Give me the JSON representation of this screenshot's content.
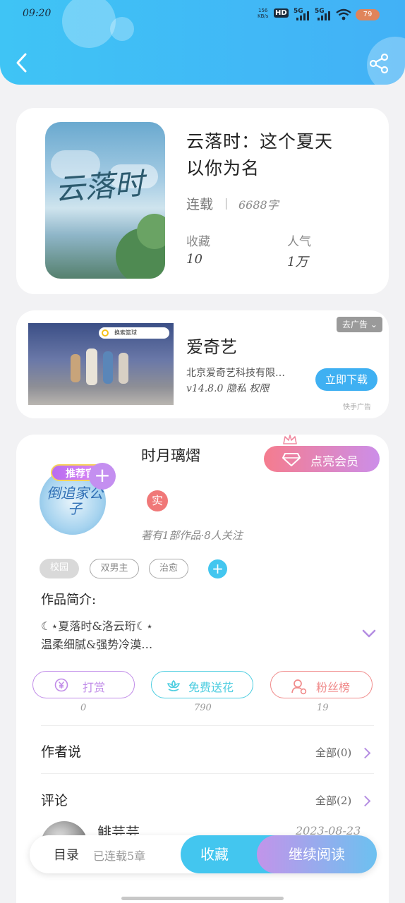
{
  "status_bar": {
    "time": "09:20",
    "net_speed_top": "156",
    "net_speed_bottom": "KB/s",
    "hd": "HD",
    "sim1": "5G",
    "sim2": "5G",
    "battery": "79"
  },
  "book": {
    "title_line1": "云落时：这个夏天",
    "title_line2": "以你为名",
    "status": "连载",
    "word_count": "6688字",
    "favorites_label": "收藏",
    "favorites_value": "10",
    "popularity_label": "人气",
    "popularity_value": "1万",
    "cover_title": "云落时"
  },
  "ad": {
    "app_name": "爱奇艺",
    "company": "北京爱奇艺科技有限…",
    "meta": "v14.8.0 隐私 权限",
    "download": "立即下载",
    "close": "去广告",
    "source": "快手广告",
    "search_hint": "换索篮球"
  },
  "author": {
    "name": "时月璃熠",
    "badge": "推荐官",
    "avatar_text": "倒追家公子",
    "verified": "实",
    "stats": "著有1部作品·8人关注",
    "vip_button": "点亮会员"
  },
  "tags": [
    "校园",
    "双男主",
    "治愈"
  ],
  "intro": {
    "label": "作品简介:",
    "line1": "☾⋆夏落时&洛云珩☾⋆",
    "line2": "温柔细腻&强势冷漠…"
  },
  "actions": [
    {
      "label": "打赏",
      "icon": "yen-icon",
      "count": "0",
      "color": "#c08be8"
    },
    {
      "label": "免费送花",
      "icon": "flower-icon",
      "count": "790",
      "color": "#4ccde0"
    },
    {
      "label": "粉丝榜",
      "icon": "user-icon",
      "count": "19",
      "color": "#f08a8a"
    }
  ],
  "sections": {
    "author_says": "作者说",
    "author_says_all": "全部(0)",
    "comments": "评论",
    "comments_all": "全部(2)"
  },
  "comment": {
    "user": "鲱芸芸",
    "date": "2023-08-23"
  },
  "bottom": {
    "catalog": "目录",
    "chapters": "已连载5章",
    "favorite": "收藏",
    "continue": "继续阅读"
  }
}
